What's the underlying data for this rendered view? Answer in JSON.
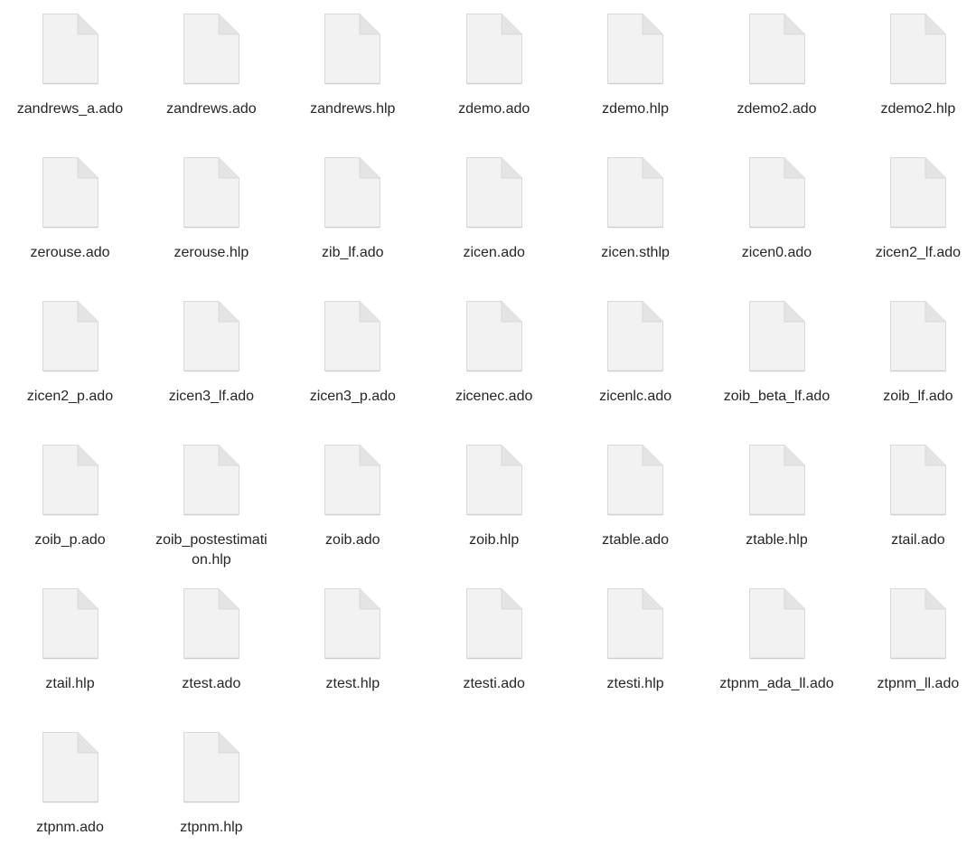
{
  "window": {
    "view": "icon-grid"
  },
  "icon": {
    "name": "document-icon",
    "fill_color": "#f2f2f2",
    "edge_color": "#d9d9d9",
    "fold_color": "#e4e4e4"
  },
  "files": [
    {
      "name": "zandrews_a.ado"
    },
    {
      "name": "zandrews.ado"
    },
    {
      "name": "zandrews.hlp"
    },
    {
      "name": "zdemo.ado"
    },
    {
      "name": "zdemo.hlp"
    },
    {
      "name": "zdemo2.ado"
    },
    {
      "name": "zdemo2.hlp"
    },
    {
      "name": "zerouse.ado"
    },
    {
      "name": "zerouse.hlp"
    },
    {
      "name": "zib_lf.ado"
    },
    {
      "name": "zicen.ado"
    },
    {
      "name": "zicen.sthlp"
    },
    {
      "name": "zicen0.ado"
    },
    {
      "name": "zicen2_lf.ado"
    },
    {
      "name": "zicen2_p.ado"
    },
    {
      "name": "zicen3_lf.ado"
    },
    {
      "name": "zicen3_p.ado"
    },
    {
      "name": "zicenec.ado"
    },
    {
      "name": "zicenlc.ado"
    },
    {
      "name": "zoib_beta_lf.ado"
    },
    {
      "name": "zoib_lf.ado"
    },
    {
      "name": "zoib_p.ado"
    },
    {
      "name": "zoib_postestimation.hlp",
      "label_lines": [
        "zoib_postestimati",
        "on.hlp"
      ]
    },
    {
      "name": "zoib.ado"
    },
    {
      "name": "zoib.hlp"
    },
    {
      "name": "ztable.ado"
    },
    {
      "name": "ztable.hlp"
    },
    {
      "name": "ztail.ado"
    },
    {
      "name": "ztail.hlp"
    },
    {
      "name": "ztest.ado"
    },
    {
      "name": "ztest.hlp"
    },
    {
      "name": "ztesti.ado"
    },
    {
      "name": "ztesti.hlp"
    },
    {
      "name": "ztpnm_ada_ll.ado"
    },
    {
      "name": "ztpnm_ll.ado"
    },
    {
      "name": "ztpnm.ado"
    },
    {
      "name": "ztpnm.hlp"
    }
  ]
}
